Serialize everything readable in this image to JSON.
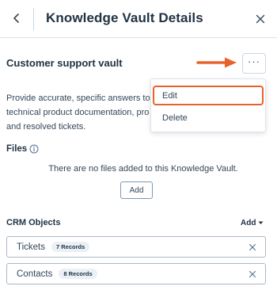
{
  "header": {
    "title": "Knowledge Vault Details"
  },
  "vault": {
    "name": "Customer support vault",
    "description_lines": [
      "Provide accurate, specific answers to",
      "technical product documentation, pro",
      "and resolved tickets."
    ]
  },
  "menu": {
    "more_label": "···",
    "items": [
      {
        "label": "Edit"
      },
      {
        "label": "Delete"
      }
    ]
  },
  "files": {
    "label": "Files",
    "empty_message": "There are no files added to this Knowledge Vault.",
    "add_label": "Add"
  },
  "crm": {
    "label": "CRM Objects",
    "add_label": "Add",
    "objects": [
      {
        "name": "Tickets",
        "badge": "7 Records"
      },
      {
        "name": "Contacts",
        "badge": "8 Records"
      }
    ]
  },
  "colors": {
    "accent_arrow": "#e8632b",
    "text_dark": "#213343",
    "text": "#33475b"
  },
  "icons": [
    "chevron-left-icon",
    "close-icon",
    "more-horizontal-icon",
    "arrow-right-icon",
    "info-icon",
    "caret-down-icon",
    "remove-icon"
  ]
}
